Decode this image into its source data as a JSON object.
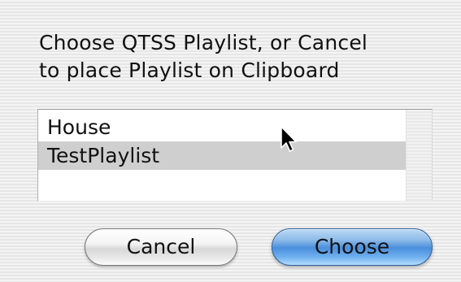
{
  "dialog": {
    "prompt_line1": "Choose QTSS Playlist, or Cancel",
    "prompt_line2": "to place Playlist on Clipboard"
  },
  "playlist": {
    "items": [
      "House",
      "TestPlaylist"
    ],
    "selected": "TestPlaylist"
  },
  "buttons": {
    "cancel_label": "Cancel",
    "choose_label": "Choose"
  },
  "icons": {
    "cursor": "arrow-cursor-icon"
  },
  "colors": {
    "default_button": "#4a8fdc",
    "selection": "#cfcfcf"
  }
}
